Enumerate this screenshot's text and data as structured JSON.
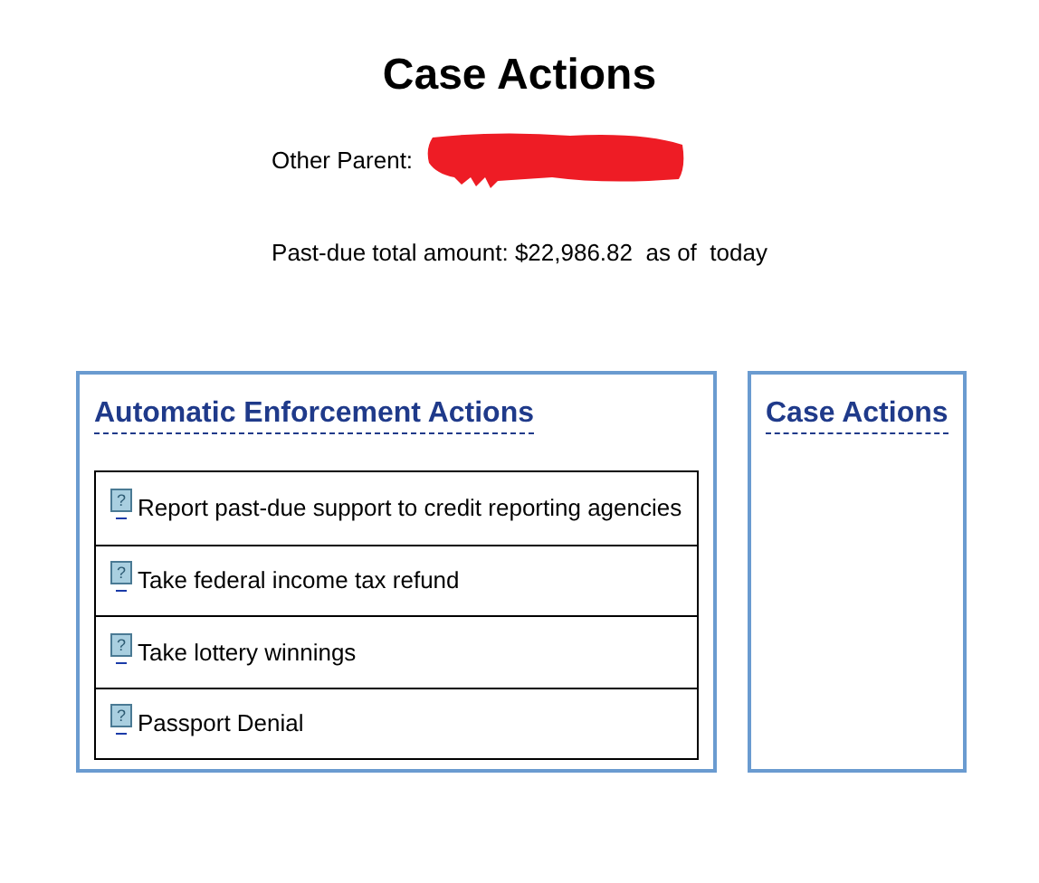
{
  "title": "Case Actions",
  "other_parent": {
    "label": "Other Parent:",
    "value_redacted": true
  },
  "past_due": "Past-due total amount: $22,986.82  as of  today",
  "enforcement_panel": {
    "heading": "Automatic Enforcement Actions",
    "items": [
      {
        "icon": "?",
        "label": "Report past-due support to credit reporting agencies"
      },
      {
        "icon": "?",
        "label": "Take federal income tax refund"
      },
      {
        "icon": "?",
        "label": "Take lottery winnings"
      },
      {
        "icon": "?",
        "label": "Passport Denial"
      }
    ]
  },
  "case_actions_panel": {
    "heading": "Case Actions"
  }
}
